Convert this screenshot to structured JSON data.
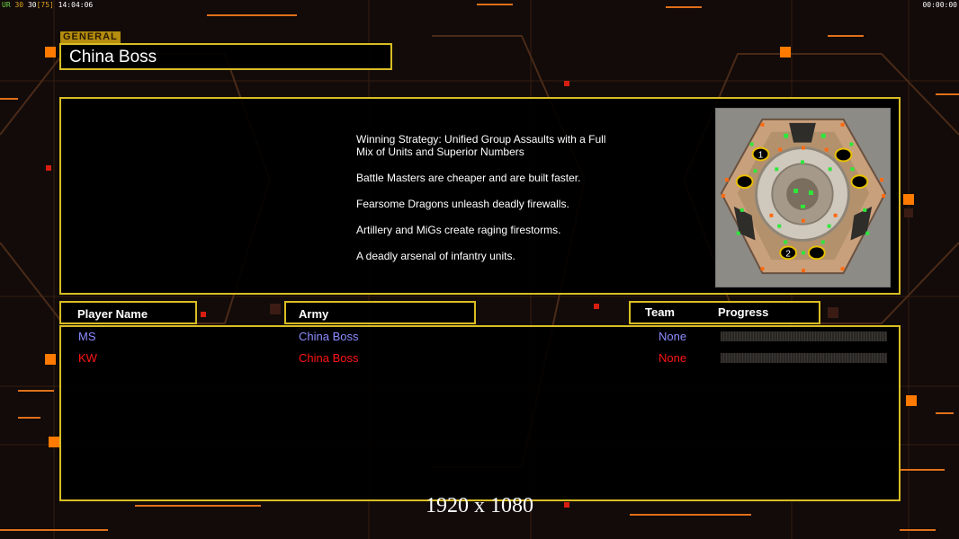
{
  "hud": {
    "fps_label": "UR",
    "fps_a": "30",
    "fps_b": "30",
    "fps_c": "[75]",
    "clock": "14:04:06",
    "timer": "00:00:00"
  },
  "general": {
    "label": "GENERAL",
    "name": "China Boss"
  },
  "strategy": [
    "Winning Strategy: Unified Group Assaults with a Full\n Mix of Units and Superior Numbers",
    "Battle Masters are cheaper and are built faster.",
    "Fearsome Dragons unleash deadly firewalls.",
    "Artillery and MiGs create raging firestorms.",
    "A deadly arsenal of infantry units."
  ],
  "minimap": {
    "start_labels": [
      "1",
      "2"
    ]
  },
  "headers": {
    "player_name": "Player Name",
    "army": "Army",
    "team": "Team",
    "progress": "Progress"
  },
  "players": [
    {
      "name": "MS",
      "army": "China Boss",
      "team": "None",
      "color": "#8c8cff",
      "progress": 0
    },
    {
      "name": "KW",
      "army": "China Boss",
      "team": "None",
      "color": "#ff1414",
      "progress": 0
    }
  ],
  "resolution": "1920 x 1080",
  "colors": {
    "frame": "#d9bd24",
    "accent_orange": "#ff7a00",
    "accent_red": "#d81e10"
  }
}
